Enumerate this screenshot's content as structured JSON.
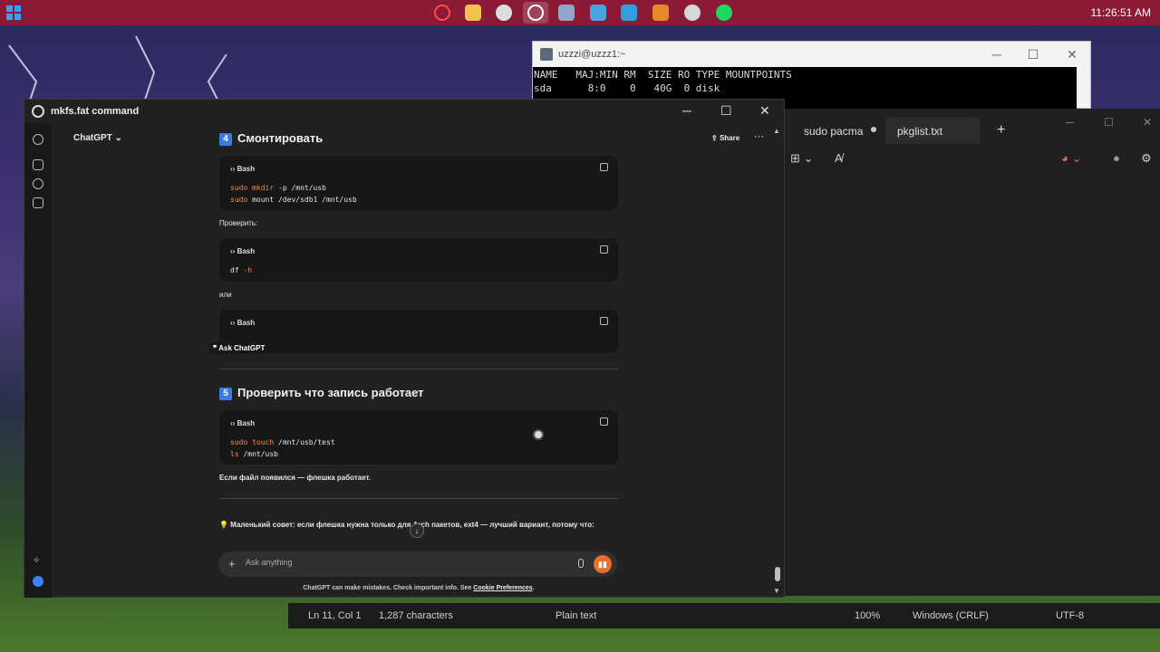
{
  "taskbar": {
    "clock": "11:26:51 AM"
  },
  "terminal": {
    "title": "uzzzi@uzzz1:~",
    "lines": "NAME   MAJ:MIN RM  SIZE RO TYPE MOUNTPOINTS\nsda      8:0    0   40G  0 disk"
  },
  "notepad": {
    "tabs": [
      "sudo pacma",
      "pkglist.txt"
    ],
    "status": {
      "position": "Ln 11, Col 1",
      "chars": "1,287 characters",
      "format": "Plain text",
      "zoom": "100%",
      "eol": "Windows (CRLF)",
      "encoding": "UTF-8"
    }
  },
  "chat": {
    "window_title": "mkfs.fat command",
    "model": "ChatGPT",
    "share": "Share",
    "section4": {
      "num": "4",
      "title": "Смонтировать"
    },
    "section5": {
      "num": "5",
      "title": "Проверить что запись работает"
    },
    "code_lang": "Bash",
    "code1": [
      "sudo",
      "mkdir",
      "-p /mnt/usb",
      "sudo",
      "mount /dev/sdb1 /mnt/usb"
    ],
    "check_label": "Проверить:",
    "code2": [
      "df",
      "-h"
    ],
    "or_label": "или",
    "ask_chatgpt": "Ask ChatGPT",
    "code4": [
      "sudo",
      "touch",
      "/mnt/usb/test",
      "ls",
      "/mnt/usb"
    ],
    "file_note": "Если файл появился — флешка работает.",
    "tip": "💡 Маленький совет: если флешка нужна только для Arch пакетов, ext4 — лучший вариант, потому что:",
    "input_placeholder": "Ask anything",
    "footer_text": "ChatGPT can make mistakes. Check important info. See",
    "footer_link": "Cookie Preferences"
  }
}
